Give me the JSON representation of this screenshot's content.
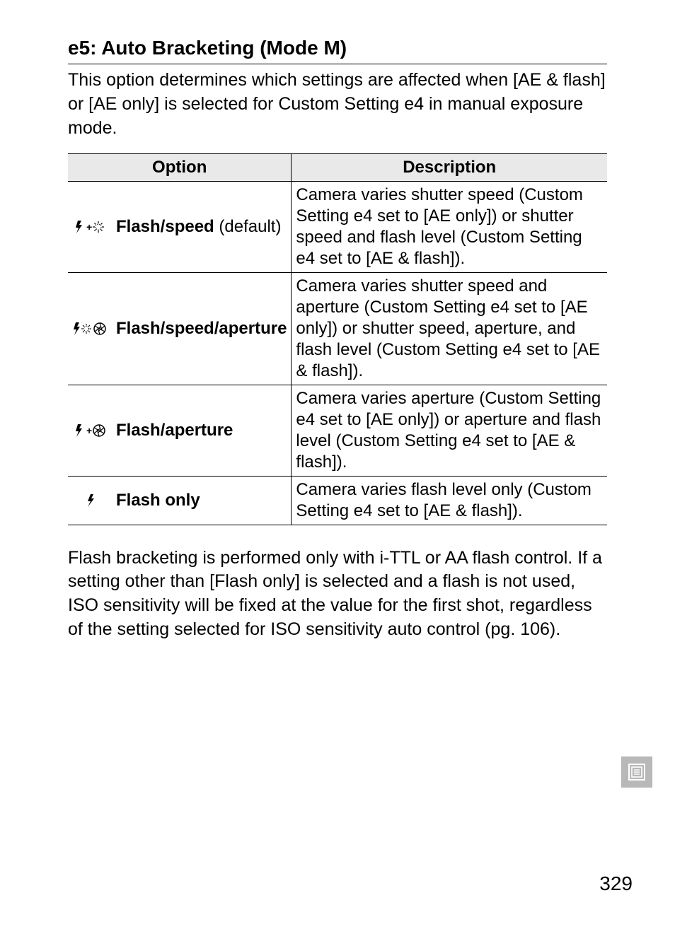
{
  "heading": "e5: Auto Bracketing (Mode M)",
  "intro": "This option determines which settings are affected when [AE & flash] or [AE only] is selected for Custom Setting e4 in manual exposure mode.",
  "table": {
    "headers": {
      "option": "Option",
      "description": "Description"
    },
    "rows": [
      {
        "option_main": "Flash/speed",
        "option_sub": "(default)",
        "description": "Camera varies shutter speed (Custom Setting e4 set to [AE only]) or shutter speed and flash level (Custom Setting e4 set to [AE & flash])."
      },
      {
        "option_main": "Flash/speed/aperture",
        "option_sub": "",
        "description": "Camera varies shutter speed and aperture (Custom Setting e4 set to [AE only]) or shutter speed, aperture, and flash level (Custom Setting e4 set to [AE & flash])."
      },
      {
        "option_main": "Flash/aperture",
        "option_sub": "",
        "description": "Camera varies aperture (Custom Setting e4 set to [AE only]) or aperture and flash level (Custom Setting e4 set to [AE & flash])."
      },
      {
        "option_main": "Flash only",
        "option_sub": "",
        "description": "Camera varies flash level only (Custom Setting e4 set to [AE & flash])."
      }
    ]
  },
  "note": "Flash bracketing is performed only with i-TTL or AA flash control.  If a setting other than [Flash only] is selected and a flash is not used, ISO sensitivity will be fixed at the value for the first shot, regardless of the setting selected for ISO sensitivity auto control (pg. 106).",
  "page_number": "329"
}
